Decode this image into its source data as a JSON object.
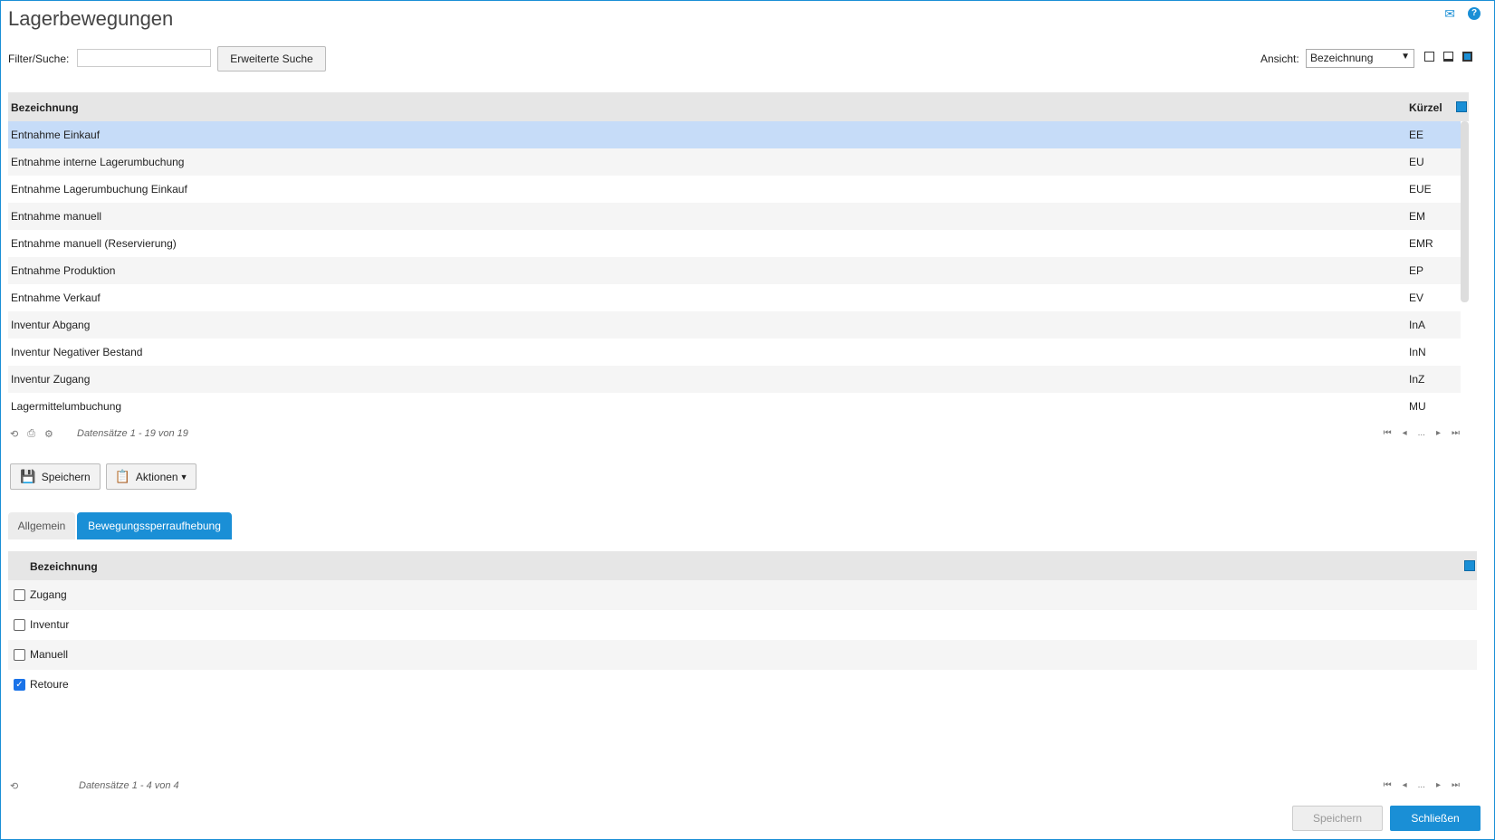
{
  "header": {
    "title": "Lagerbewegungen",
    "mail_icon": "mail-icon",
    "help_icon": "help-icon"
  },
  "toolbar": {
    "filter_label": "Filter/Suche:",
    "filter_value": "",
    "advanced_search_label": "Erweiterte Suche",
    "view_label": "Ansicht:",
    "view_selected": "Bezeichnung"
  },
  "grid": {
    "columns": [
      "Bezeichnung",
      "Kürzel"
    ],
    "rows": [
      {
        "name": "Entnahme Einkauf",
        "code": "EE"
      },
      {
        "name": "Entnahme interne Lagerumbuchung",
        "code": "EU"
      },
      {
        "name": "Entnahme Lagerumbuchung Einkauf",
        "code": "EUE"
      },
      {
        "name": "Entnahme manuell",
        "code": "EM"
      },
      {
        "name": "Entnahme manuell (Reservierung)",
        "code": "EMR"
      },
      {
        "name": "Entnahme Produktion",
        "code": "EP"
      },
      {
        "name": "Entnahme Verkauf",
        "code": "EV"
      },
      {
        "name": "Inventur Abgang",
        "code": "InA"
      },
      {
        "name": "Inventur Negativer Bestand",
        "code": "InN"
      },
      {
        "name": "Inventur Zugang",
        "code": "InZ"
      },
      {
        "name": "Lagermittelumbuchung",
        "code": "MU"
      }
    ],
    "selected_index": 0,
    "record_info": "Datensätze 1 - 19 von 19",
    "pager_ellipsis": "..."
  },
  "actions": {
    "save_label": "Speichern",
    "actions_label": "Aktionen"
  },
  "tabs": [
    {
      "label": "Allgemein",
      "active": false
    },
    {
      "label": "Bewegungssperraufhebung",
      "active": true
    }
  ],
  "subgrid": {
    "column": "Bezeichnung",
    "rows": [
      {
        "label": "Zugang",
        "checked": false
      },
      {
        "label": "Inventur",
        "checked": false
      },
      {
        "label": "Manuell",
        "checked": false
      },
      {
        "label": "Retoure",
        "checked": true
      }
    ],
    "record_info": "Datensätze 1 - 4 von 4",
    "pager_ellipsis": "..."
  },
  "footer": {
    "save_label": "Speichern",
    "close_label": "Schließen"
  },
  "colors": {
    "accent": "#1a8fd6",
    "selected_row": "#c6dcf8",
    "header_bg": "#e6e6e6"
  }
}
